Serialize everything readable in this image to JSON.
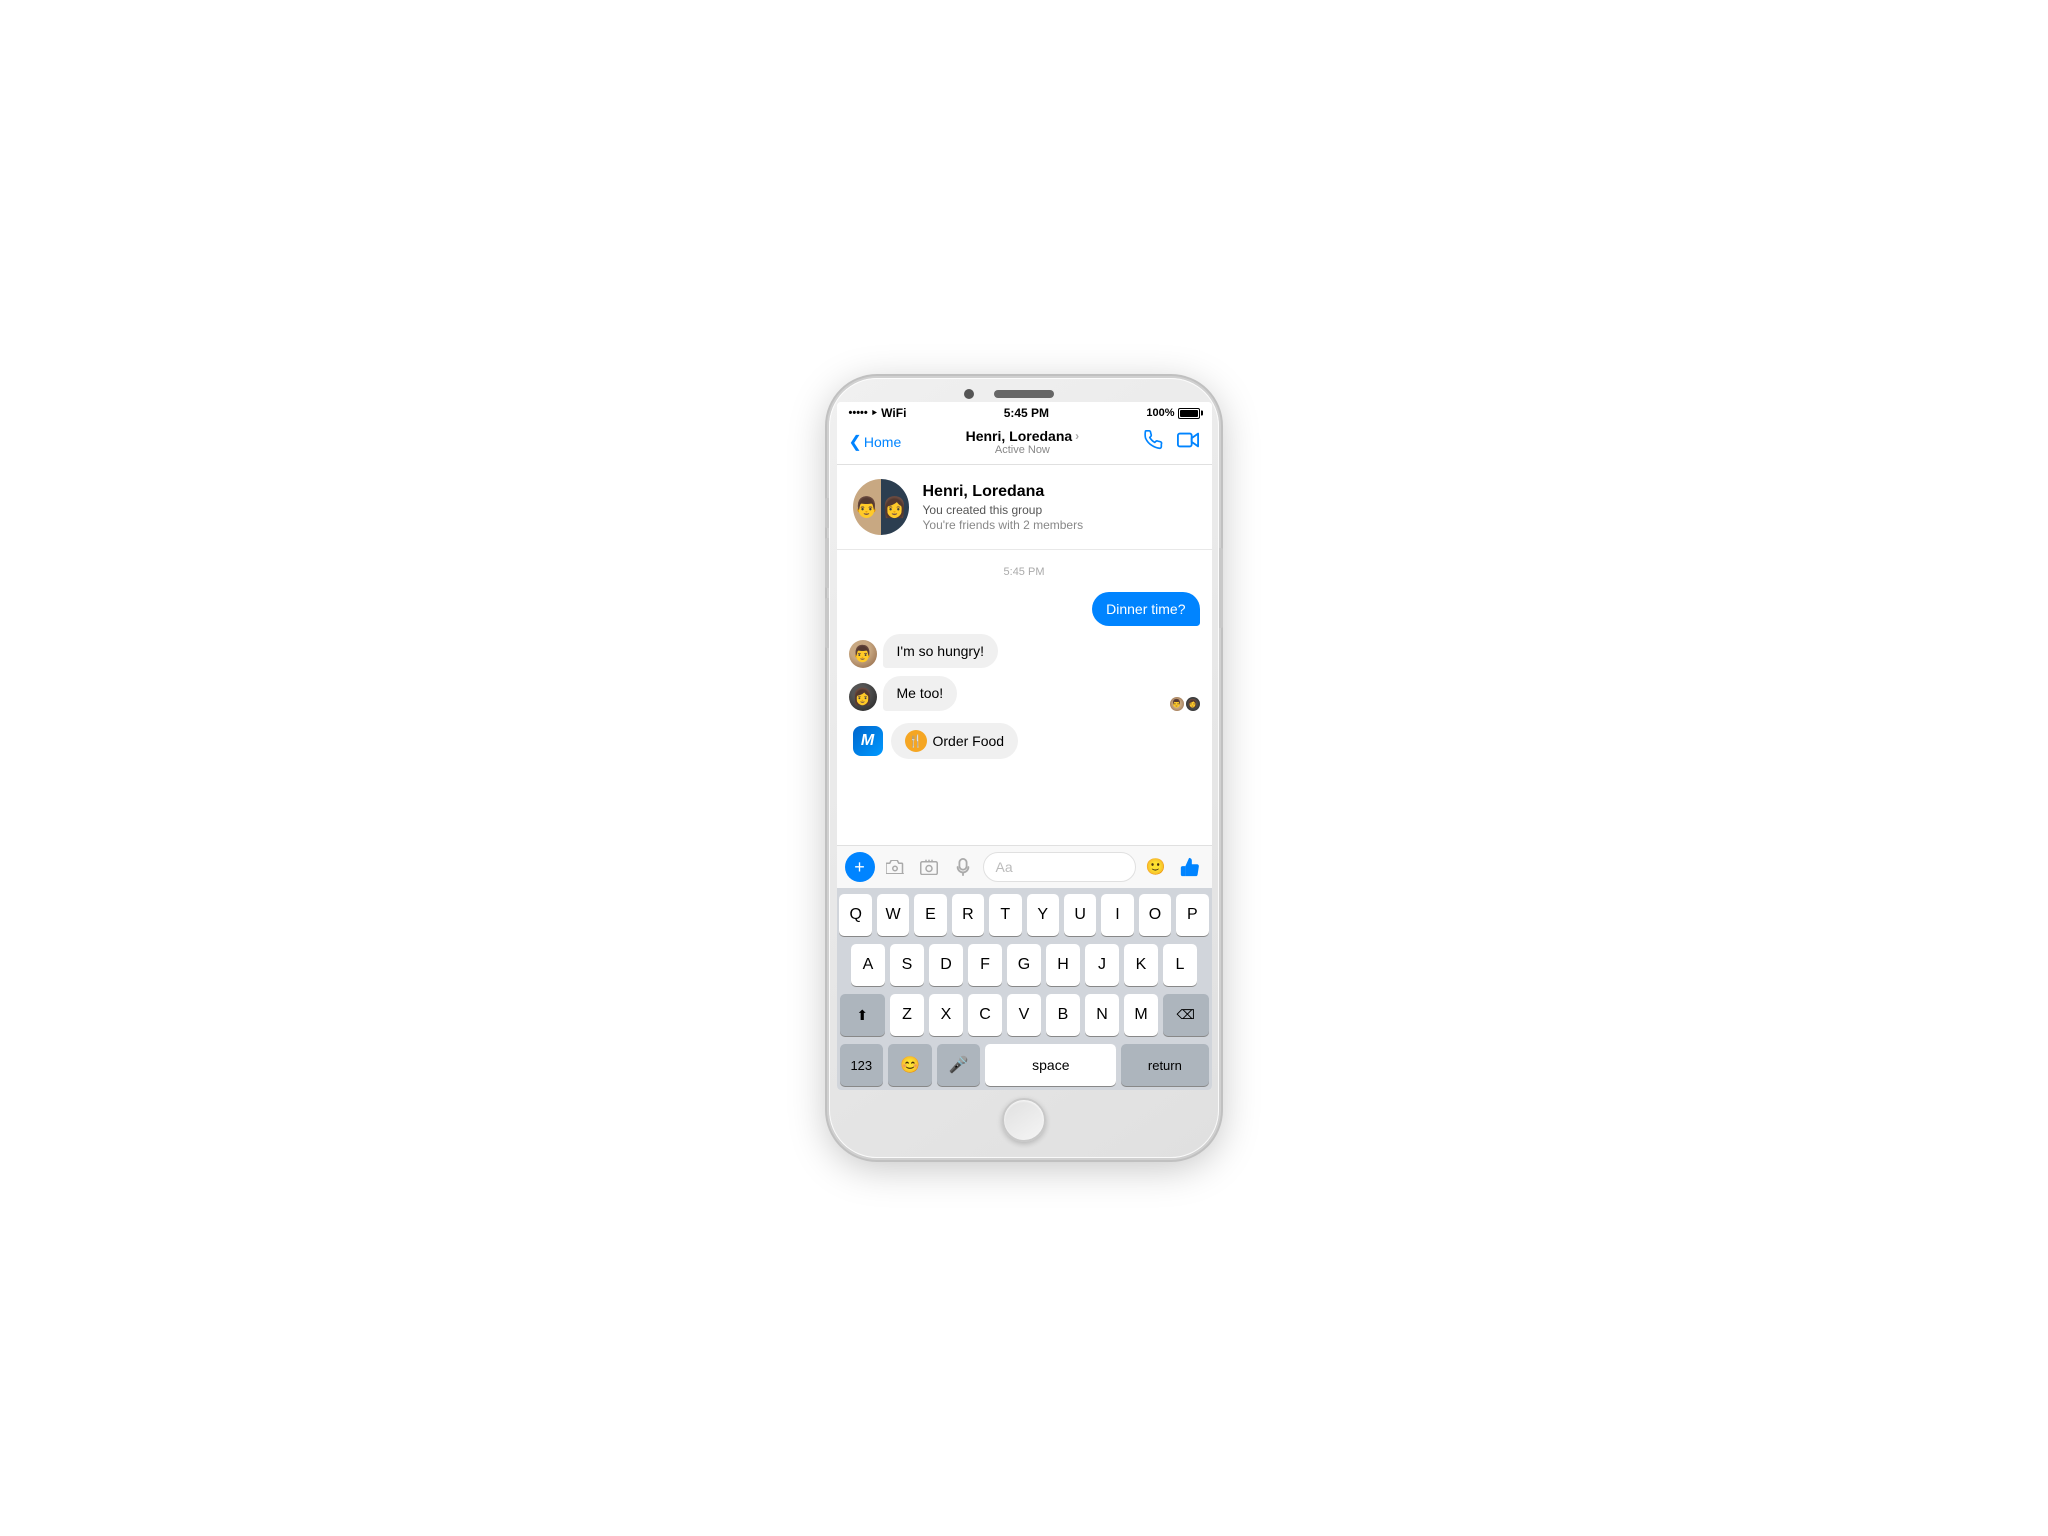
{
  "phone": {
    "status_bar": {
      "signal_dots": "•••••",
      "wifi": "WiFi",
      "time": "5:45 PM",
      "battery_label": "100%"
    },
    "nav": {
      "back_label": "Home",
      "contact_name": "Henri, Loredana",
      "chevron": "›",
      "active_status": "Active Now"
    },
    "group_header": {
      "name": "Henri, Loredana",
      "created": "You created this group",
      "friends": "You're friends with 2 members"
    },
    "messages": [
      {
        "type": "time",
        "text": "5:45 PM"
      },
      {
        "type": "sent",
        "text": "Dinner time?"
      },
      {
        "type": "received",
        "sender": "man",
        "text": "I'm so hungry!"
      },
      {
        "type": "received",
        "sender": "woman",
        "text": "Me too!"
      }
    ],
    "m_suggestion": {
      "icon_label": "M",
      "button_label": "Order Food"
    },
    "input_bar": {
      "placeholder": "Aa",
      "plus_label": "+",
      "thumb_label": "👍"
    },
    "keyboard": {
      "row1": [
        "Q",
        "W",
        "E",
        "R",
        "T",
        "Y",
        "U",
        "I",
        "O",
        "P"
      ],
      "row2": [
        "A",
        "S",
        "D",
        "F",
        "G",
        "H",
        "J",
        "K",
        "L"
      ],
      "row3": [
        "Z",
        "X",
        "C",
        "V",
        "B",
        "N",
        "M"
      ],
      "row4_num": "123",
      "row4_emoji": "😊",
      "row4_mic": "🎤",
      "row4_space": "space",
      "row4_return": "return",
      "shift_symbol": "⬆",
      "delete_symbol": "⌫"
    }
  }
}
